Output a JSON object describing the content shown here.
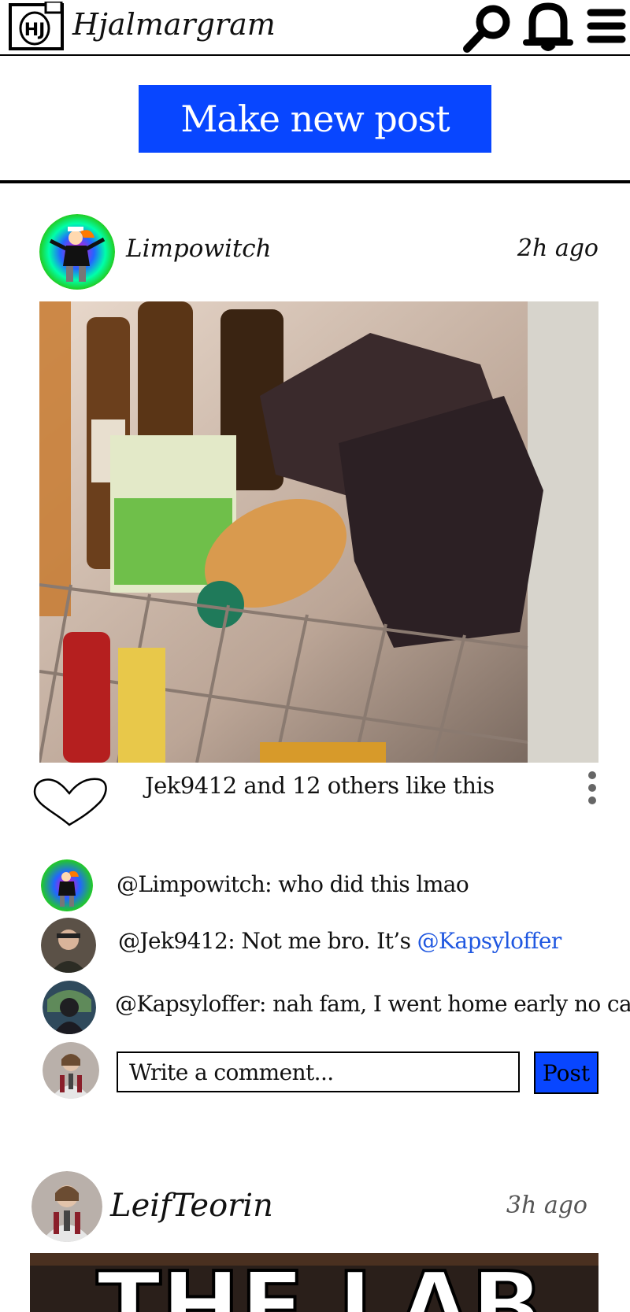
{
  "header": {
    "logo_text": "HJ",
    "title": "Hjalmargram",
    "icons": [
      "search-icon",
      "bell-icon",
      "menu-icon"
    ]
  },
  "new_post_label": "Make new post",
  "colors": {
    "accent": "#0846ff",
    "mention": "#1f57e0"
  },
  "posts": [
    {
      "username": "Limpowitch",
      "time": "2h ago",
      "likes_text": "Jek9412 and 12 others like this",
      "comments": [
        {
          "text": "@Limpowitch: who did this lmao"
        },
        {
          "text": "@Jek9412: Not me bro. It’s ",
          "mention": "@Kapsyloffer"
        },
        {
          "text": "@Kapsyloffer: nah fam, I went home early no cap"
        }
      ],
      "comment_placeholder": "Write a comment...",
      "comment_button": "Post"
    },
    {
      "username": "LeifTeorin",
      "time": "3h ago",
      "image_text": "THE LAB"
    }
  ]
}
